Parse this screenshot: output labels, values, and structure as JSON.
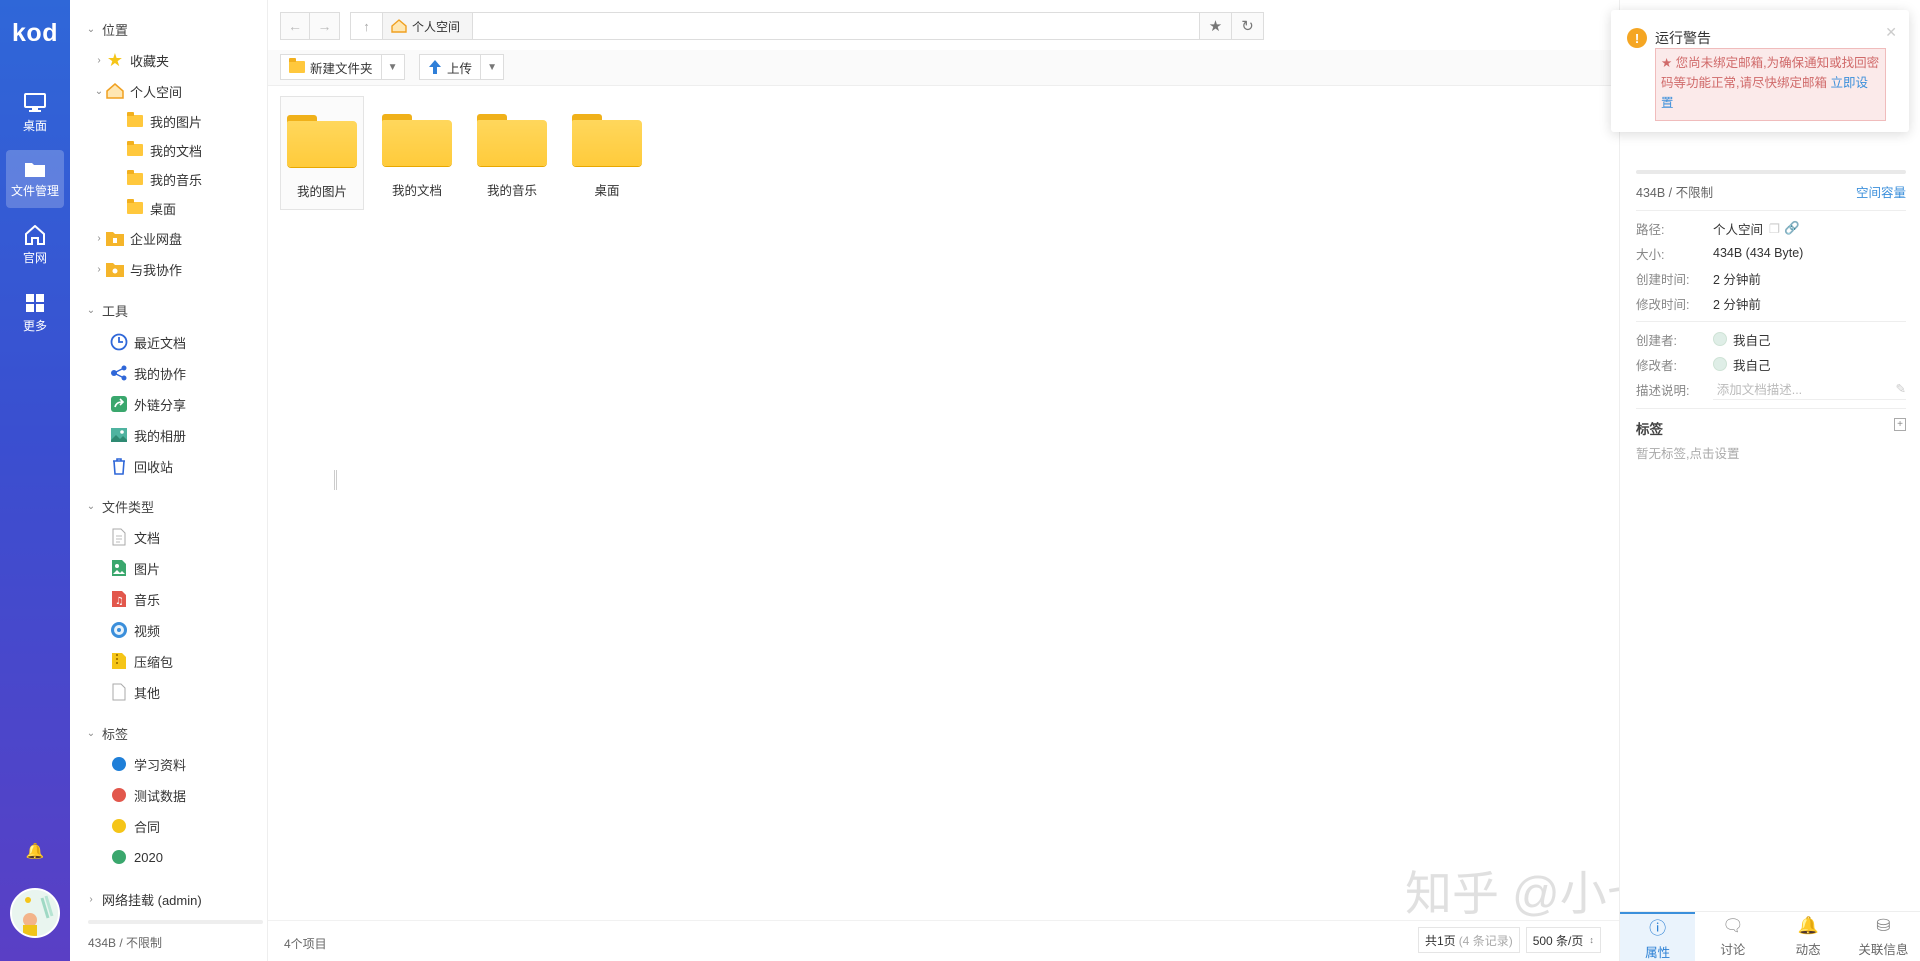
{
  "appbar": {
    "logo": "kod",
    "items": [
      {
        "label": "桌面",
        "icon": "monitor-icon"
      },
      {
        "label": "文件管理",
        "icon": "folder-icon"
      },
      {
        "label": "官网",
        "icon": "home-icon"
      },
      {
        "label": "更多",
        "icon": "grid-icon"
      }
    ],
    "bell_icon": "bell-icon"
  },
  "tree": {
    "location_title": "位置",
    "favorites": "收藏夹",
    "personal": "个人空间",
    "personal_children": [
      "我的图片",
      "我的文档",
      "我的音乐",
      "桌面"
    ],
    "enterprise": "企业网盘",
    "shared": "与我协作",
    "tools_title": "工具",
    "tools": [
      "最近文档",
      "我的协作",
      "外链分享",
      "我的相册",
      "回收站"
    ],
    "filetypes_title": "文件类型",
    "filetypes": [
      "文档",
      "图片",
      "音乐",
      "视频",
      "压缩包",
      "其他"
    ],
    "tags_title": "标签",
    "tags": [
      {
        "label": "学习资料",
        "color": "#1f7fd8"
      },
      {
        "label": "测试数据",
        "color": "#e2574c"
      },
      {
        "label": "合同",
        "color": "#f5c518"
      },
      {
        "label": "2020",
        "color": "#3aa76d"
      }
    ],
    "network": "网络挂载 (admin)",
    "quota": "434B / 不限制"
  },
  "address": {
    "crumb": "个人空间"
  },
  "toolbar": {
    "new_folder": "新建文件夹",
    "upload": "上传"
  },
  "files": [
    {
      "name": "我的图片"
    },
    {
      "name": "我的文档"
    },
    {
      "name": "我的音乐"
    },
    {
      "name": "桌面"
    }
  ],
  "footer": {
    "count": "4个项目",
    "pages": "共1页",
    "records": "(4 条记录)",
    "page_size": "500 条/页"
  },
  "watermark": "知乎 @小七逗你玩",
  "right_panel": {
    "quota": "434B / 不限制",
    "quota_link": "空间容量",
    "path_key": "路径:",
    "path_val": "个人空间",
    "size_key": "大小:",
    "size_val": "434B (434 Byte)",
    "created_key": "创建时间:",
    "created_val": "2 分钟前",
    "modified_key": "修改时间:",
    "modified_val": "2 分钟前",
    "creator_key": "创建者:",
    "creator_val": "我自己",
    "modifier_key": "修改者:",
    "modifier_val": "我自己",
    "desc_key": "描述说明:",
    "desc_placeholder": "添加文档描述...",
    "tags_title": "标签",
    "tags_empty": "暂无标签,点击设置",
    "tabs": [
      "属性",
      "讨论",
      "动态",
      "关联信息"
    ]
  },
  "toast": {
    "title": "运行警告",
    "message": "★ 您尚未绑定邮箱,为确保通知或找回密码等功能正常,请尽快绑定邮箱",
    "link": "立即设置"
  }
}
